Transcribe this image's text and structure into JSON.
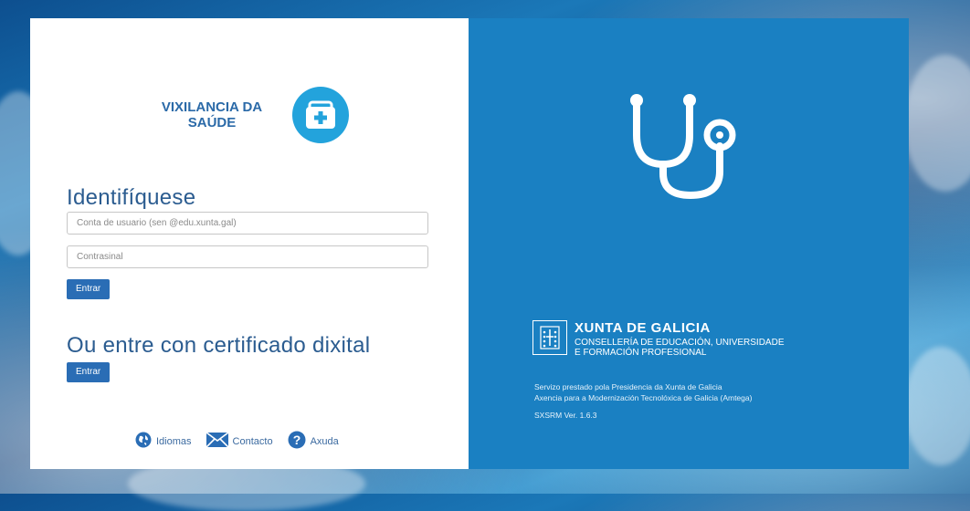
{
  "logo": {
    "line1": "VIXILANCIA DA",
    "line2": "SAÚDE",
    "icon": "medical-kit-icon"
  },
  "login": {
    "heading": "Identifíquese",
    "username_placeholder": "Conta de usuario (sen @edu.xunta.gal)",
    "password_placeholder": "Contrasinal",
    "submit_label": "Entrar"
  },
  "certificate": {
    "heading": "Ou entre con certificado dixital",
    "submit_label": "Entrar"
  },
  "footer": {
    "languages": "Idiomas",
    "contact": "Contacto",
    "help": "Axuda"
  },
  "right_panel": {
    "hero_icon": "stethoscope-icon",
    "org_title": "XUNTA DE GALICIA",
    "org_sub1": "CONSELLERÍA DE EDUCACIÓN, UNIVERSIDADE",
    "org_sub2": "E FORMACIÓN PROFESIONAL",
    "service_line1": "Servizo prestado pola Presidencia da Xunta de Galicia",
    "service_line2": "Axencia para a Modernización Tecnolóxica de Galicia (Amtega)",
    "version": "SXSRM Ver. 1.6.3"
  },
  "colors": {
    "panel_blue": "#1a80c2",
    "button_blue": "#2a6db5",
    "heading_blue": "#2b5c90",
    "icon_cyan": "#23a3dc"
  }
}
